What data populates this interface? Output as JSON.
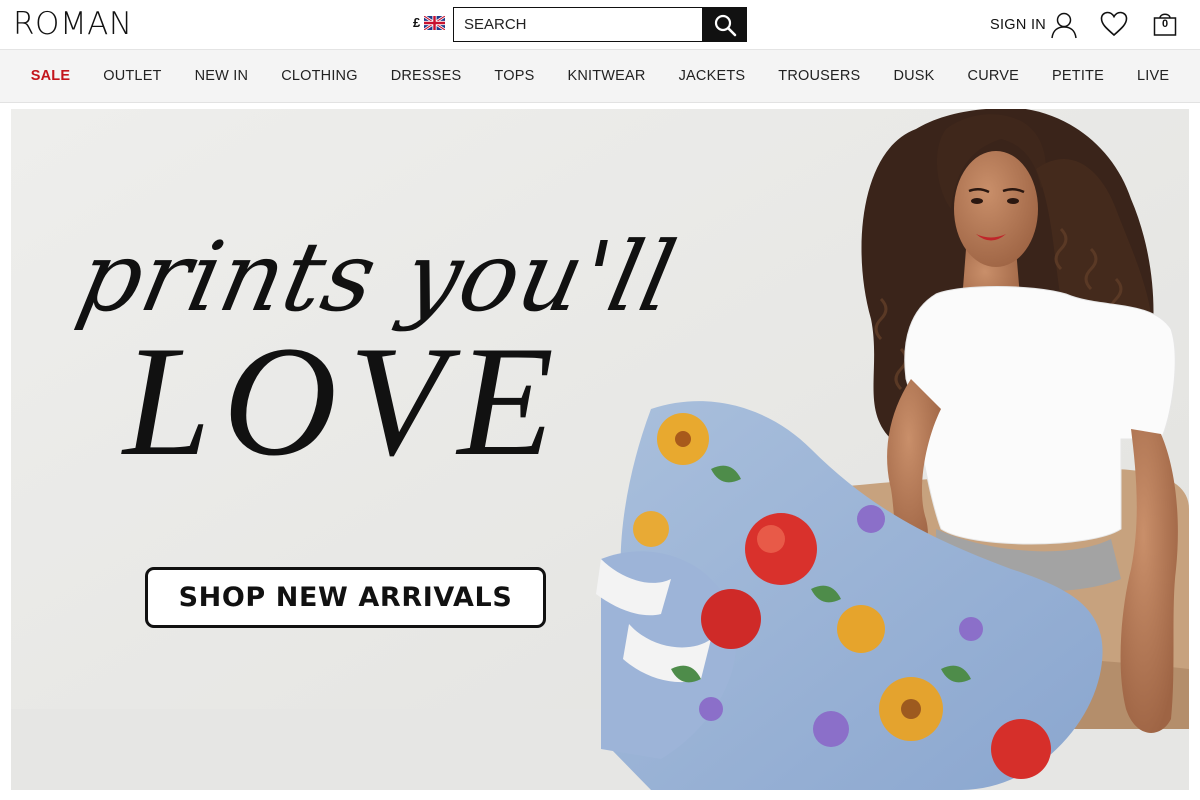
{
  "brand": {
    "logo_text": "ROMAN"
  },
  "header": {
    "currency_symbol": "£",
    "flag_icon": "uk-flag-icon",
    "search": {
      "placeholder": "SEARCH",
      "value": "",
      "icon": "search-icon"
    },
    "signin_label": "SIGN IN",
    "signin_icon": "user-icon",
    "wishlist_icon": "heart-icon",
    "bag_icon": "shopping-bag-icon",
    "bag_count": "0"
  },
  "nav": {
    "items": [
      {
        "label": "SALE",
        "highlight": true
      },
      {
        "label": "OUTLET"
      },
      {
        "label": "NEW IN"
      },
      {
        "label": "CLOTHING"
      },
      {
        "label": "DRESSES"
      },
      {
        "label": "TOPS"
      },
      {
        "label": "KNITWEAR"
      },
      {
        "label": "JACKETS"
      },
      {
        "label": "TROUSERS"
      },
      {
        "label": "DUSK"
      },
      {
        "label": "CURVE"
      },
      {
        "label": "PETITE"
      },
      {
        "label": "LIVE"
      }
    ]
  },
  "hero": {
    "script_text": "prints you'll",
    "headline": "LOVE",
    "cta_label": "SHOP NEW ARRIVALS"
  },
  "colors": {
    "sale_red": "#c3151c",
    "text_black": "#111111",
    "nav_bg": "#f4f4f4",
    "hero_bg": "#ebebe9"
  }
}
